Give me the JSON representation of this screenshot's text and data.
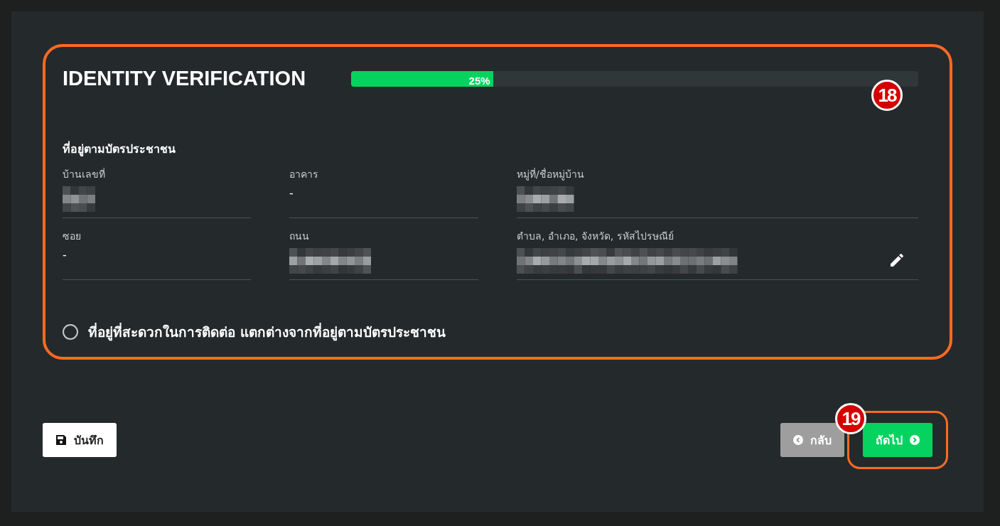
{
  "card": {
    "title": "IDENTITY VERIFICATION",
    "progress": {
      "level": 0.25,
      "reading": "25%"
    },
    "highlighted": true,
    "annotation": "18"
  },
  "section": {
    "heading": "ที่อยู่ตามบัตรประชาชน",
    "fields": [
      {
        "label": "บ้านเลขที่",
        "redacted": true,
        "editable": false
      },
      {
        "label": "อาคาร",
        "value": "-",
        "redacted": false,
        "editable": false
      },
      {
        "label": "หมู่ที่/ชื่อหมู่บ้าน",
        "redacted": true,
        "editable": false
      },
      {
        "label": "ซอย",
        "value": "-",
        "redacted": false,
        "editable": false
      },
      {
        "label": "ถนน",
        "redacted": true,
        "editable": false
      },
      {
        "label": "ตำบล, อำเภอ, จังหวัด, รหัสไปรษณีย์",
        "redacted": true,
        "editable": true
      }
    ]
  },
  "option": {
    "label": "ที่อยู่ที่สะดวกในการติดต่อ แตกต่างจากที่อยู่ตามบัตรประชาชน",
    "selected": false
  },
  "buttons": [
    {
      "kind": "save",
      "label": "บันทึก"
    },
    {
      "kind": "back",
      "label": "กลับ"
    },
    {
      "kind": "next",
      "label": "ถัดไป",
      "highlighted": true,
      "annotation": "19"
    }
  ]
}
